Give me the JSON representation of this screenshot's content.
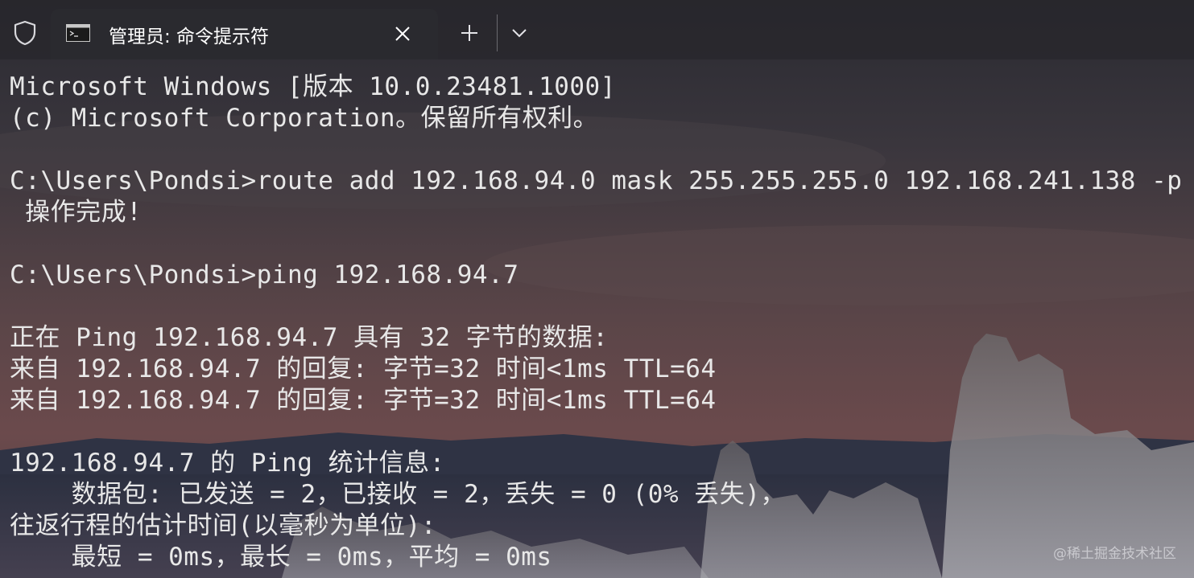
{
  "window": {
    "tab_title": "管理员: 命令提示符"
  },
  "icons": {
    "shield": "shield-icon",
    "tab": "cmd-icon",
    "close": "close-icon",
    "new_tab": "plus-icon",
    "dropdown": "chevron-down-icon"
  },
  "terminal": {
    "lines": [
      "Microsoft Windows [版本 10.0.23481.1000]",
      "(c) Microsoft Corporation。保留所有权利。",
      "",
      "C:\\Users\\Pondsi>route add 192.168.94.0 mask 255.255.255.0 192.168.241.138 -p",
      " 操作完成!",
      "",
      "C:\\Users\\Pondsi>ping 192.168.94.7",
      "",
      "正在 Ping 192.168.94.7 具有 32 字节的数据:",
      "来自 192.168.94.7 的回复: 字节=32 时间<1ms TTL=64",
      "来自 192.168.94.7 的回复: 字节=32 时间<1ms TTL=64",
      "",
      "192.168.94.7 的 Ping 统计信息:",
      "    数据包: 已发送 = 2，已接收 = 2，丢失 = 0 (0% 丢失)，",
      "往返行程的估计时间(以毫秒为单位):",
      "    最短 = 0ms，最长 = 0ms，平均 = 0ms"
    ]
  },
  "watermark": "@稀土掘金技术社区",
  "colors": {
    "text": "#e8e8e8",
    "tab_bg": "#2a2a2f"
  }
}
